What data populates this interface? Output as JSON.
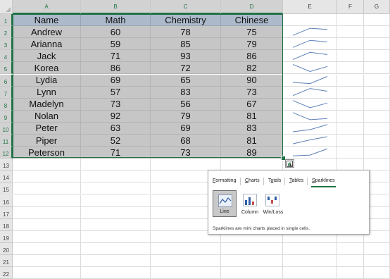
{
  "sheet": {
    "columns": [
      "A",
      "B",
      "C",
      "D",
      "E",
      "F",
      "G"
    ],
    "row_numbers": [
      "1",
      "2",
      "3",
      "4",
      "5",
      "6",
      "7",
      "8",
      "9",
      "10",
      "11",
      "12",
      "13",
      "14",
      "15",
      "16",
      "17",
      "18",
      "19",
      "20",
      "21",
      "22"
    ],
    "table": {
      "headers": [
        "Name",
        "Math",
        "Chemistry",
        "Chinese"
      ],
      "rows": [
        [
          "Andrew",
          "60",
          "78",
          "75"
        ],
        [
          "Arianna",
          "59",
          "85",
          "79"
        ],
        [
          "Jack",
          "71",
          "93",
          "86"
        ],
        [
          "Korea",
          "86",
          "72",
          "82"
        ],
        [
          "Lydia",
          "69",
          "65",
          "90"
        ],
        [
          "Lynn",
          "57",
          "83",
          "73"
        ],
        [
          "Madelyn",
          "73",
          "56",
          "67"
        ],
        [
          "Nolan",
          "92",
          "79",
          "81"
        ],
        [
          "Peter",
          "63",
          "69",
          "83"
        ],
        [
          "Piper",
          "52",
          "68",
          "81"
        ],
        [
          "Peterson",
          "71",
          "73",
          "89"
        ]
      ]
    },
    "sparkline_color": "#5b7fb8",
    "selection_color": "#217346"
  },
  "quick_analysis": {
    "button_icon": "quick-analysis-icon",
    "tabs": [
      {
        "label": "Formatting",
        "accel": "F"
      },
      {
        "label": "Charts",
        "accel": "C"
      },
      {
        "label": "Totals",
        "accel": "o"
      },
      {
        "label": "Tables",
        "accel": "T"
      },
      {
        "label": "Sparklines",
        "accel": "S",
        "active": true
      }
    ],
    "options": [
      {
        "label": "Line",
        "icon": "line-sparkline-icon",
        "selected": true
      },
      {
        "label": "Column",
        "icon": "column-sparkline-icon",
        "selected": false
      },
      {
        "label": "Win/Loss",
        "icon": "winloss-sparkline-icon",
        "selected": false
      }
    ],
    "description": "Sparklines are mini charts placed in single cells."
  }
}
